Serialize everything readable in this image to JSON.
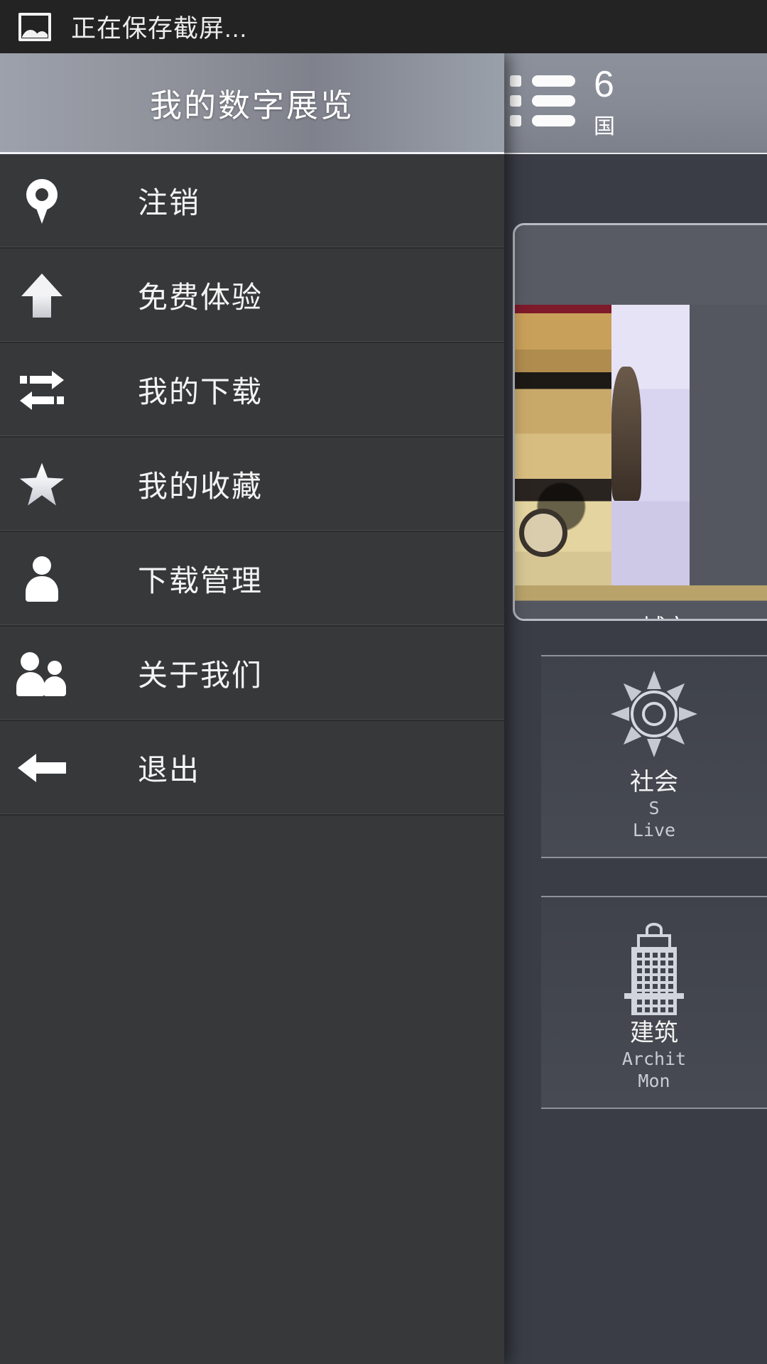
{
  "statusbar": {
    "icon": "image-saving-icon",
    "text": "正在保存截屏..."
  },
  "drawer": {
    "title": "我的数字展览",
    "items": [
      {
        "label": "注销",
        "icon": "location-pin-icon"
      },
      {
        "label": "免费体验",
        "icon": "arrow-up-icon"
      },
      {
        "label": "我的下载",
        "icon": "transfer-arrows-icon"
      },
      {
        "label": "我的收藏",
        "icon": "star-icon"
      },
      {
        "label": "下载管理",
        "icon": "person-icon"
      },
      {
        "label": "关于我们",
        "icon": "people-icon"
      },
      {
        "label": "退出",
        "icon": "arrow-left-icon"
      }
    ]
  },
  "content": {
    "actionbar": {
      "menu_icon": "list-icon",
      "title": "6",
      "subtitle": "国"
    },
    "featured_card": {
      "caption": "城市"
    },
    "categories": [
      {
        "cn": "社会",
        "en_line1": "S",
        "en_line2": "Live",
        "icon": "sun-rays-icon"
      },
      {
        "cn": "建筑",
        "en_line1": "Archit",
        "en_line2": "Mon",
        "icon": "building-icon"
      }
    ]
  },
  "colors": {
    "drawer_bg": "#37383a",
    "content_bg": "#3a3d46",
    "statusbar_bg": "#232323",
    "header_accent": "#8d9099",
    "text_primary": "#f4f4f4"
  }
}
